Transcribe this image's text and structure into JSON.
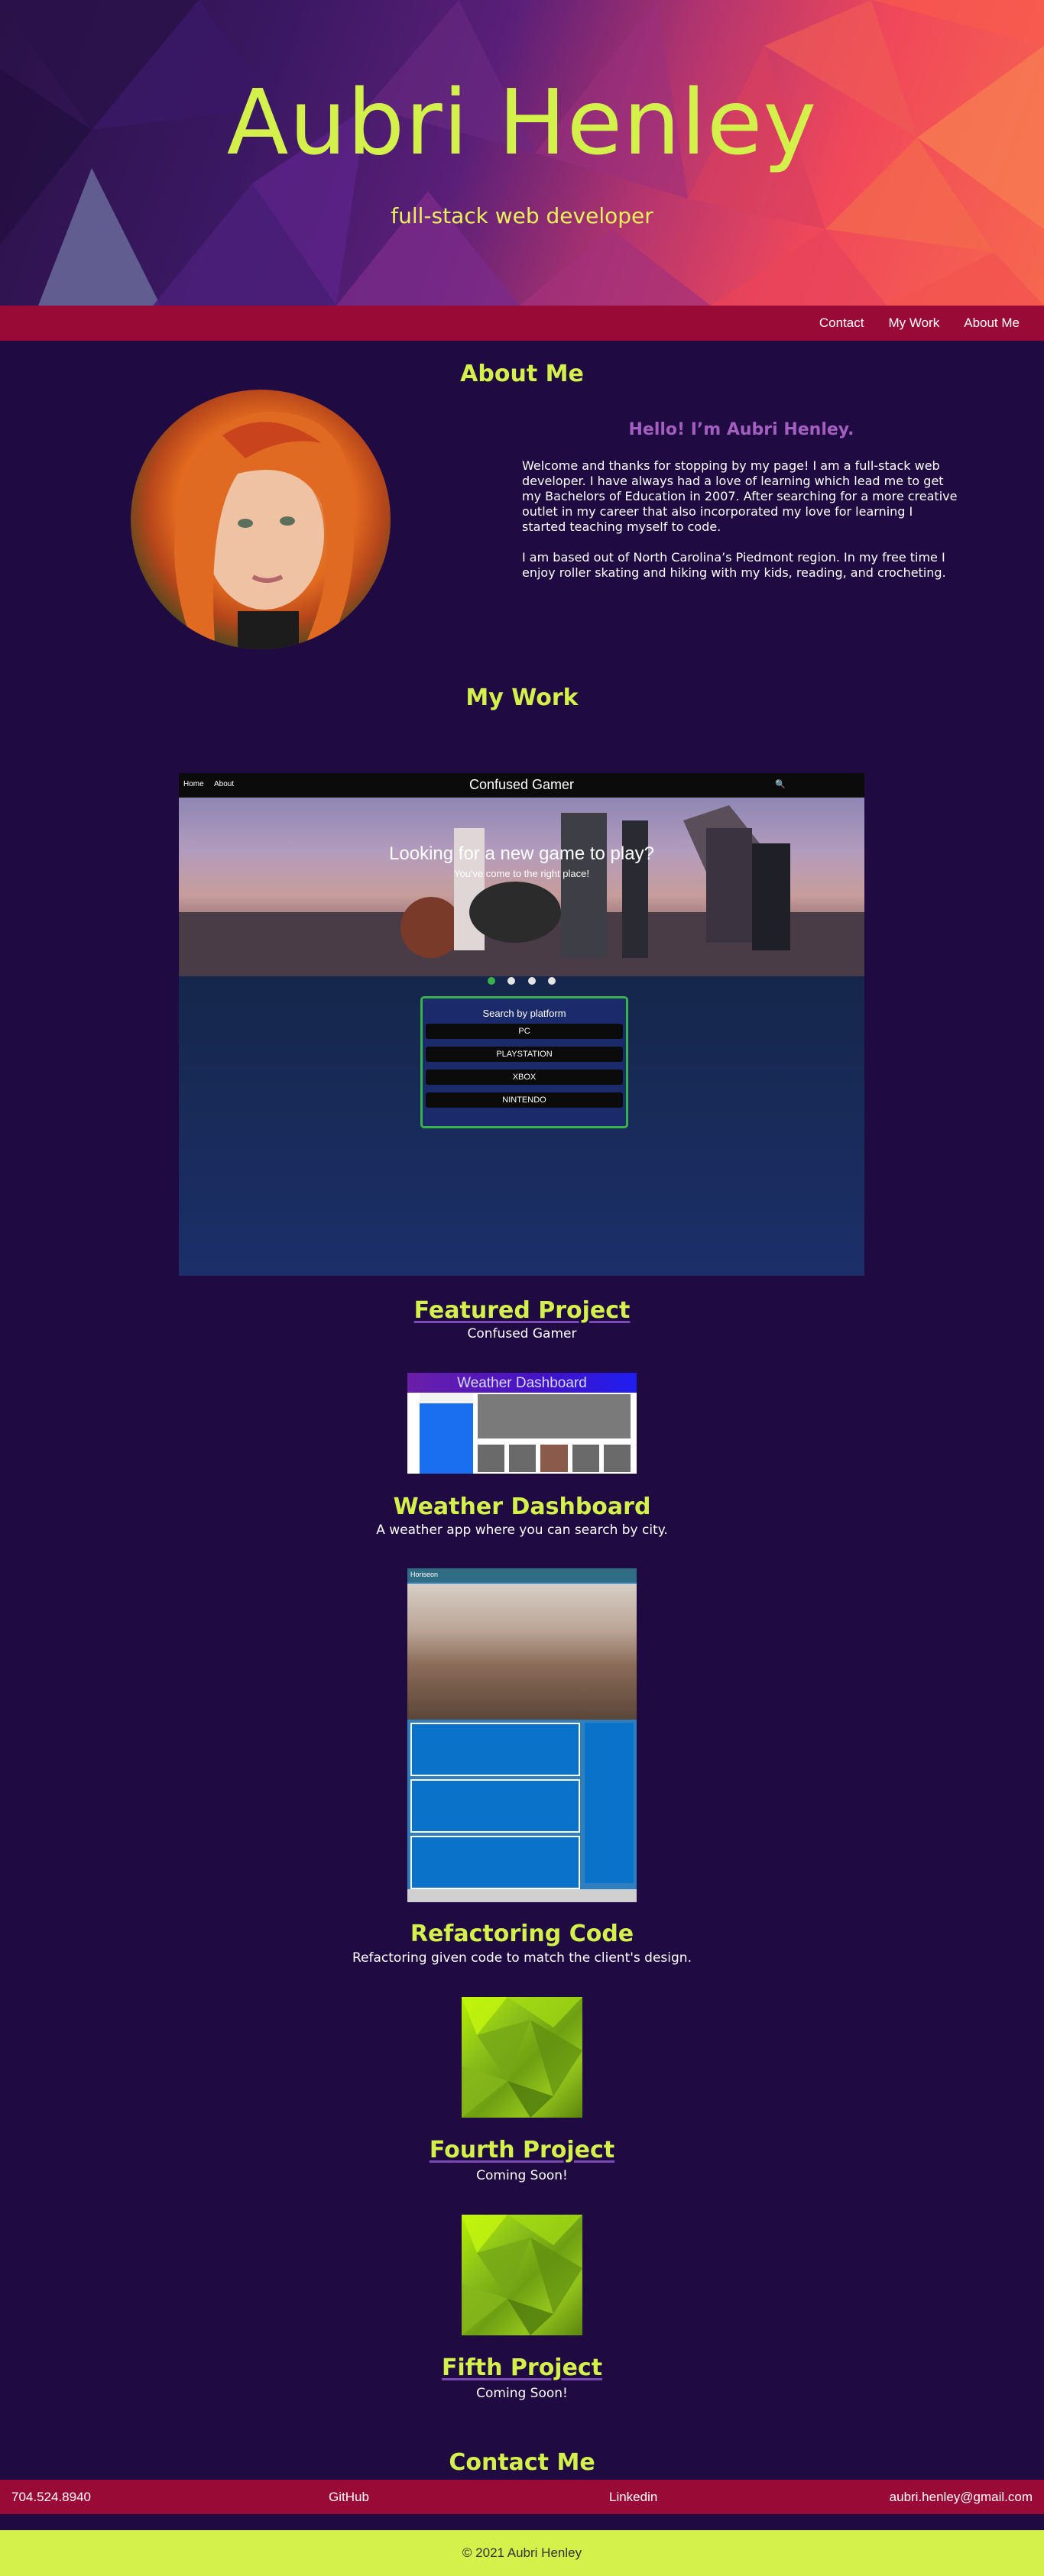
{
  "hero": {
    "title": "Aubri Henley",
    "subtitle": "full-stack web developer"
  },
  "nav": {
    "items": [
      {
        "label": "Contact"
      },
      {
        "label": "My Work"
      },
      {
        "label": "About Me"
      }
    ]
  },
  "about": {
    "section_title": "About Me",
    "heading": "Hello! I’m Aubri Henley.",
    "paragraphs": [
      "Welcome and thanks for stopping by my page! I am a full-stack web developer. I have always had a love of learning which lead me to get my Bachelors of Education in 2007. After searching for a more creative outlet in my career that also incorporated my love for learning I started teaching myself to code.",
      "I am based out of North Carolina’s Piedmont region. In my free time I enjoy roller skating and hiking with my kids, reading, and crocheting."
    ]
  },
  "work": {
    "section_title": "My Work",
    "featured_screenshot": {
      "nav_home": "Home",
      "nav_about": "About",
      "site_title": "Confused Gamer",
      "banner_heading": "Looking for a new game to play?",
      "banner_sub": "You've come to the right place!",
      "search_label": "Search by platform",
      "platforms": [
        "PC",
        "PLAYSTATION",
        "XBOX",
        "NINTENDO"
      ]
    },
    "projects": [
      {
        "title": "Featured Project",
        "description": "Confused Gamer"
      },
      {
        "title": "Weather Dashboard",
        "description": "A weather app where you can search by city.",
        "thumb_title": "Weather Dashboard"
      },
      {
        "title": "Refactoring Code",
        "description": "Refactoring given code to match the client's design.",
        "thumb_title": "Horiseon"
      },
      {
        "title": "Fourth Project",
        "description": "Coming Soon!"
      },
      {
        "title": "Fifth Project",
        "description": "Coming Soon!"
      }
    ]
  },
  "contact": {
    "section_title": "Contact Me",
    "phone": "704.524.8940",
    "github": "GitHub",
    "linkedin": "Linkedin",
    "email": "aubri.henley@gmail.com"
  },
  "footer": {
    "copyright": "© 2021 Aubri Henley"
  },
  "colors": {
    "background": "#1f0b42",
    "accent": "#d4f04a",
    "bar": "#9a0a36",
    "about_heading": "#a35fbf"
  }
}
